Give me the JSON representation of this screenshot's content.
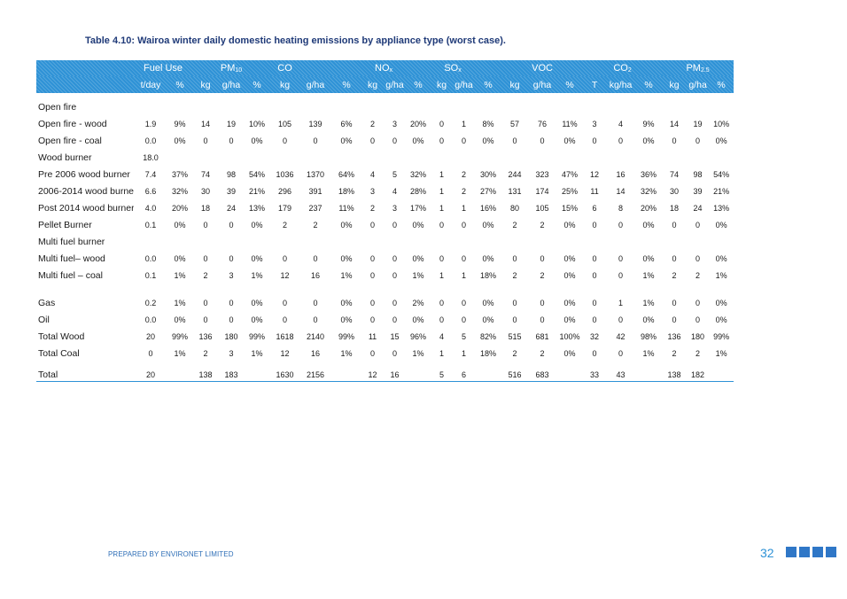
{
  "title": "Table 4.10: Wairoa winter daily domestic heating emissions by appliance type (worst case).",
  "header_groups": [
    {
      "label": "Fuel Use",
      "span": 2,
      "sub": ""
    },
    {
      "label": "PM",
      "span": 3,
      "sub": "10"
    },
    {
      "label": "CO",
      "span": 1,
      "sub": ""
    },
    {
      "label": "",
      "span": 2,
      "sub": ""
    },
    {
      "label": "NO",
      "span": 2,
      "sub": "x"
    },
    {
      "label": "",
      "span": 1,
      "sub": ""
    },
    {
      "label": "SO",
      "span": 2,
      "sub": "x"
    },
    {
      "label": "",
      "span": 1,
      "sub": ""
    },
    {
      "label": "VOC",
      "span": 3,
      "sub": ""
    },
    {
      "label": "CO",
      "span": 3,
      "sub": "2"
    },
    {
      "label": "PM",
      "span": 3,
      "sub": "2.5"
    }
  ],
  "sub_headers": [
    "t/day",
    "%",
    "kg",
    "g/ha",
    "%",
    "kg",
    "g/ha",
    "%",
    "kg",
    "g/ha",
    "%",
    "kg",
    "g/ha",
    "%",
    "kg",
    "g/ha",
    "%",
    "T",
    "kg/ha",
    "%",
    "kg",
    "g/ha",
    "%"
  ],
  "rows": [
    {
      "label": "Open fire",
      "cells": [
        "",
        "",
        "",
        "",
        "",
        "",
        "",
        "",
        "",
        "",
        "",
        "",
        "",
        "",
        "",
        "",
        "",
        "",
        "",
        "",
        "",
        "",
        ""
      ]
    },
    {
      "label": "Open fire - wood",
      "cells": [
        "1.9",
        "9%",
        "14",
        "19",
        "10%",
        "105",
        "139",
        "6%",
        "2",
        "3",
        "20%",
        "0",
        "1",
        "8%",
        "57",
        "76",
        "11%",
        "3",
        "4",
        "9%",
        "14",
        "19",
        "10%"
      ]
    },
    {
      "label": "Open fire - coal",
      "cells": [
        "0.0",
        "0%",
        "0",
        "0",
        "0%",
        "0",
        "0",
        "0%",
        "0",
        "0",
        "0%",
        "0",
        "0",
        "0%",
        "0",
        "0",
        "0%",
        "0",
        "0",
        "0%",
        "0",
        "0",
        "0%"
      ]
    },
    {
      "label": "Wood burner",
      "cells": [
        "18.0",
        "",
        "",
        "",
        "",
        "",
        "",
        "",
        "",
        "",
        "",
        "",
        "",
        "",
        "",
        "",
        "",
        "",
        "",
        "",
        "",
        "",
        ""
      ]
    },
    {
      "label": "Pre 2006 wood burner",
      "cells": [
        "7.4",
        "37%",
        "74",
        "98",
        "54%",
        "1036",
        "1370",
        "64%",
        "4",
        "5",
        "32%",
        "1",
        "2",
        "30%",
        "244",
        "323",
        "47%",
        "12",
        "16",
        "36%",
        "74",
        "98",
        "54%"
      ]
    },
    {
      "label": "2006-2014 wood burner",
      "cells": [
        "6.6",
        "32%",
        "30",
        "39",
        "21%",
        "296",
        "391",
        "18%",
        "3",
        "4",
        "28%",
        "1",
        "2",
        "27%",
        "131",
        "174",
        "25%",
        "11",
        "14",
        "32%",
        "30",
        "39",
        "21%"
      ]
    },
    {
      "label": "Post 2014 wood burner",
      "cells": [
        "4.0",
        "20%",
        "18",
        "24",
        "13%",
        "179",
        "237",
        "11%",
        "2",
        "3",
        "17%",
        "1",
        "1",
        "16%",
        "80",
        "105",
        "15%",
        "6",
        "8",
        "20%",
        "18",
        "24",
        "13%"
      ]
    },
    {
      "label": "Pellet Burner",
      "cells": [
        "0.1",
        "0%",
        "0",
        "0",
        "0%",
        "2",
        "2",
        "0%",
        "0",
        "0",
        "0%",
        "0",
        "0",
        "0%",
        "2",
        "2",
        "0%",
        "0",
        "0",
        "0%",
        "0",
        "0",
        "0%"
      ]
    },
    {
      "label": "Multi fuel burner",
      "cells": [
        "",
        "",
        "",
        "",
        "",
        "",
        "",
        "",
        "",
        "",
        "",
        "",
        "",
        "",
        "",
        "",
        "",
        "",
        "",
        "",
        "",
        "",
        ""
      ]
    },
    {
      "label": "Multi fuel– wood",
      "cells": [
        "0.0",
        "0%",
        "0",
        "0",
        "0%",
        "0",
        "0",
        "0%",
        "0",
        "0",
        "0%",
        "0",
        "0",
        "0%",
        "0",
        "0",
        "0%",
        "0",
        "0",
        "0%",
        "0",
        "0",
        "0%"
      ]
    },
    {
      "label": "Multi fuel – coal",
      "cells": [
        "0.1",
        "1%",
        "2",
        "3",
        "1%",
        "12",
        "16",
        "1%",
        "0",
        "0",
        "1%",
        "1",
        "1",
        "18%",
        "2",
        "2",
        "0%",
        "0",
        "0",
        "1%",
        "2",
        "2",
        "1%"
      ]
    },
    {
      "label": "Gas",
      "cells": [
        "0.2",
        "1%",
        "0",
        "0",
        "0%",
        "0",
        "0",
        "0%",
        "0",
        "0",
        "2%",
        "0",
        "0",
        "0%",
        "0",
        "0",
        "0%",
        "0",
        "1",
        "1%",
        "0",
        "0",
        "0%"
      ]
    },
    {
      "label": "Oil",
      "cells": [
        "0.0",
        "0%",
        "0",
        "0",
        "0%",
        "0",
        "0",
        "0%",
        "0",
        "0",
        "0%",
        "0",
        "0",
        "0%",
        "0",
        "0",
        "0%",
        "0",
        "0",
        "0%",
        "0",
        "0",
        "0%"
      ]
    },
    {
      "label": "Total Wood",
      "cells": [
        "20",
        "99%",
        "136",
        "180",
        "99%",
        "1618",
        "2140",
        "99%",
        "11",
        "15",
        "96%",
        "4",
        "5",
        "82%",
        "515",
        "681",
        "100%",
        "32",
        "42",
        "98%",
        "136",
        "180",
        "99%"
      ]
    },
    {
      "label": "Total Coal",
      "cells": [
        "0",
        "1%",
        "2",
        "3",
        "1%",
        "12",
        "16",
        "1%",
        "0",
        "0",
        "1%",
        "1",
        "1",
        "18%",
        "2",
        "2",
        "0%",
        "0",
        "0",
        "1%",
        "2",
        "2",
        "1%"
      ]
    },
    {
      "label": "Total",
      "cells": [
        "20",
        "",
        "138",
        "183",
        "",
        "1630",
        "2156",
        "",
        "12",
        "16",
        "",
        "5",
        "6",
        "",
        "516",
        "683",
        "",
        "33",
        "43",
        "",
        "138",
        "182",
        ""
      ]
    }
  ],
  "footer": "PREPARED BY ENVIRONET LIMITED",
  "page_number": "32",
  "colors": {
    "accent": "#2e92d6",
    "title": "#1f3a78",
    "squares": "#2f77c7"
  }
}
